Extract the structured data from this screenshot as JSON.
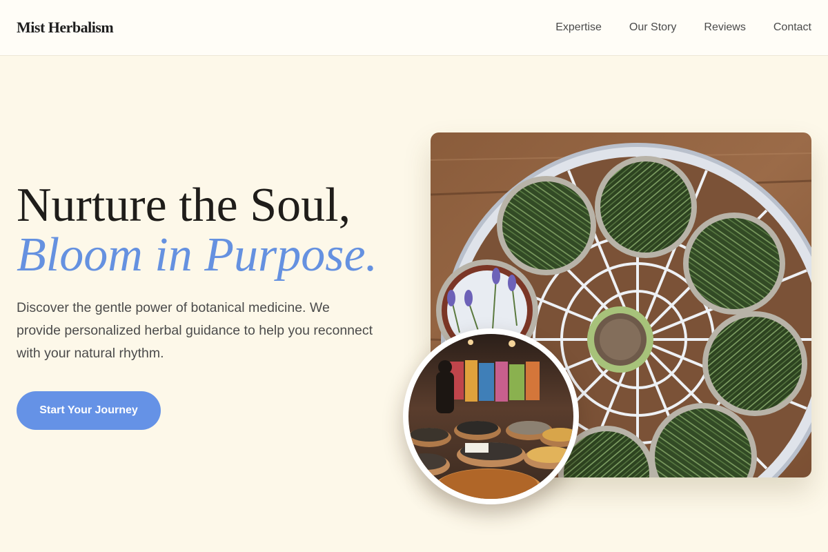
{
  "nav": {
    "brand": "Mist Herbalism",
    "links": [
      "Expertise",
      "Our Story",
      "Reviews",
      "Contact"
    ]
  },
  "hero": {
    "title_line1": "Nurture the Soul,",
    "title_line2": "Bloom in Purpose.",
    "description": "Discover the gentle power of botanical medicine. We provide personalized herbal guidance to help you reconnect with your natural rhythm.",
    "cta_label": "Start Your Journey"
  },
  "images": {
    "main": "drying-herbs-rack-photo",
    "inset": "spice-market-photo"
  },
  "colors": {
    "page_background": "#fdf8e9",
    "accent_blue": "#6592e6",
    "heading_dark": "#1f1d1a"
  }
}
